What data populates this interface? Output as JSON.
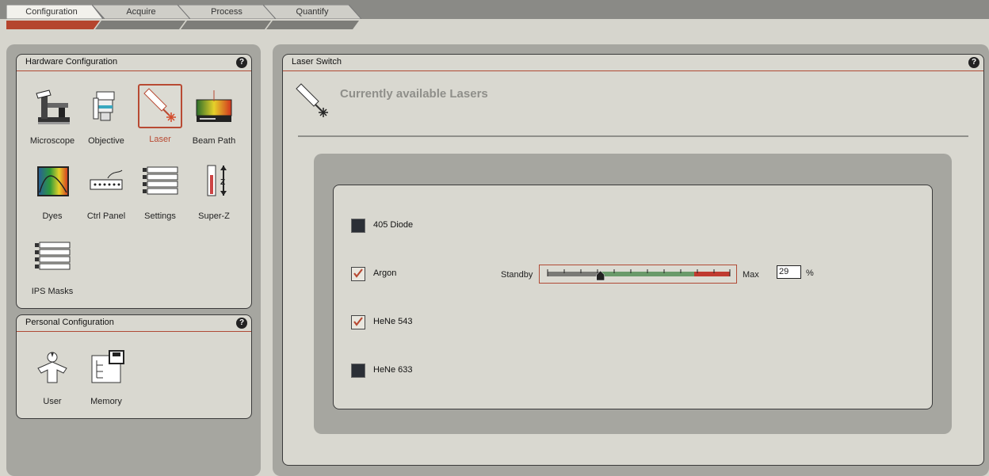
{
  "tabs": [
    {
      "label": "Configuration",
      "active": true
    },
    {
      "label": "Acquire",
      "active": false
    },
    {
      "label": "Process",
      "active": false
    },
    {
      "label": "Quantify",
      "active": false
    }
  ],
  "hardware": {
    "title": "Hardware Configuration",
    "help": "?",
    "items": [
      {
        "label": "Microscope",
        "icon": "microscope-icon"
      },
      {
        "label": "Objective",
        "icon": "objective-icon"
      },
      {
        "label": "Laser",
        "icon": "laser-icon",
        "selected": true
      },
      {
        "label": "Beam Path",
        "icon": "beam-path-icon"
      },
      {
        "label": "Dyes",
        "icon": "dyes-icon"
      },
      {
        "label": "Ctrl Panel",
        "icon": "ctrl-panel-icon"
      },
      {
        "label": "Settings",
        "icon": "settings-icon"
      },
      {
        "label": "Super-Z",
        "icon": "super-z-icon"
      },
      {
        "label": "IPS Masks",
        "icon": "ips-masks-icon"
      }
    ]
  },
  "personal": {
    "title": "Personal Configuration",
    "help": "?",
    "items": [
      {
        "label": "User",
        "icon": "user-icon"
      },
      {
        "label": "Memory",
        "icon": "memory-icon"
      }
    ]
  },
  "laser_switch": {
    "title": "Laser Switch",
    "help": "?",
    "heading": "Currently available Lasers",
    "lasers": [
      {
        "name": "405 Diode",
        "checked": false
      },
      {
        "name": "Argon",
        "checked": true
      },
      {
        "name": "HeNe 543",
        "checked": true
      },
      {
        "name": "HeNe 633",
        "checked": false
      }
    ],
    "slider": {
      "min_label": "Standby",
      "max_label": "Max",
      "value": "29",
      "unit": "%",
      "fraction": 0.29
    }
  },
  "colors": {
    "accent": "#b84a33",
    "panel": "#a6a6a0",
    "background": "#d6d5cd"
  }
}
